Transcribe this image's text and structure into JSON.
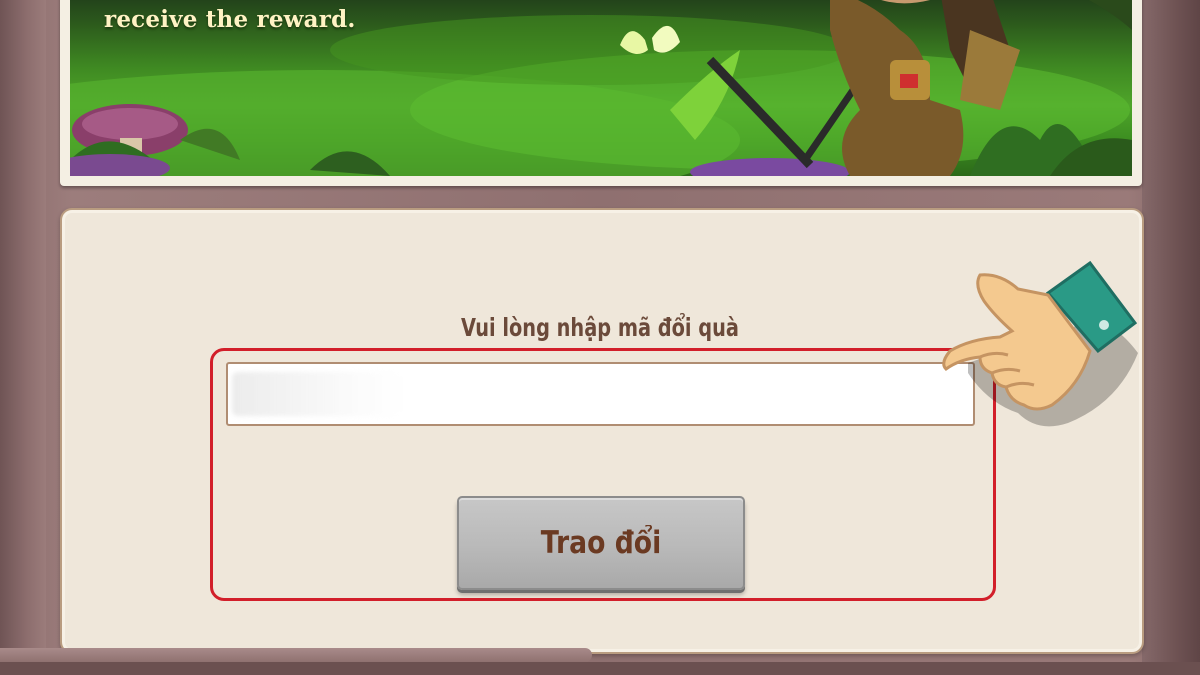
{
  "banner": {
    "caption_line": "receive the reward."
  },
  "redeem": {
    "prompt": "Vui lòng nhập mã đổi quà",
    "code_value": "",
    "button_label": "Trao đổi"
  },
  "colors": {
    "panel_bg": "#efe7da",
    "highlight": "#d21f2a",
    "button_bg": "#b9b9b9",
    "label_text": "#6b4a3a",
    "frame": "#8f7070"
  },
  "icons": [
    "pointing-hand-icon"
  ]
}
